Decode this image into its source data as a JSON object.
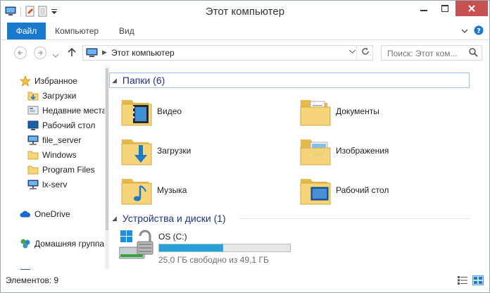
{
  "window": {
    "title": "Этот компьютер"
  },
  "ribbon": {
    "tabs": [
      "Файл",
      "Компьютер",
      "Вид"
    ]
  },
  "address": {
    "path": "Этот компьютер"
  },
  "search": {
    "placeholder": "Поиск: Этот ком..."
  },
  "nav_pane": {
    "favorites": "Избранное",
    "items": [
      "Загрузки",
      "Недавние места",
      "Рабочий стол",
      "file_server",
      "Windows",
      "Program Files",
      "lx-serv"
    ],
    "onedrive": "OneDrive",
    "homegroup": "Домашняя группа",
    "partial": "Э"
  },
  "folders": {
    "header": "Папки (6)",
    "items": [
      "Видео",
      "Документы",
      "Загрузки",
      "Изображения",
      "Музыка",
      "Рабочий стол"
    ]
  },
  "devices": {
    "header": "Устройства и диски (1)",
    "drive": {
      "name": "OS (C:)",
      "free_text": "25,0 ГБ свободно из 49,1 ГБ",
      "used_fraction": 0.49
    }
  },
  "status": {
    "count": "Элементов: 9"
  },
  "colors": {
    "accent": "#1979ca",
    "close": "#c75050",
    "header_text": "#1e3287",
    "drive_bar": "#26a0da"
  }
}
